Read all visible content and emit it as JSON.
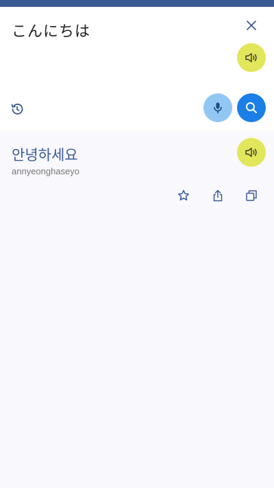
{
  "input": {
    "source_text": "こんにちは",
    "icons": {
      "close": "close-icon",
      "speak": "speaker-icon",
      "history": "history-icon",
      "mic": "microphone-icon",
      "search": "search-icon"
    }
  },
  "result": {
    "translated_text": "안녕하세요",
    "romanization": "annyeonghaseyo",
    "icons": {
      "speak": "speaker-icon",
      "favorite": "star-icon",
      "share": "share-icon",
      "copy": "copy-icon"
    }
  },
  "colors": {
    "status_bar": "#3b5b94",
    "speaker_button": "#e2e65a",
    "mic_button": "#92c7f3",
    "search_button": "#1a7fe6",
    "accent_text": "#3b5b94"
  }
}
